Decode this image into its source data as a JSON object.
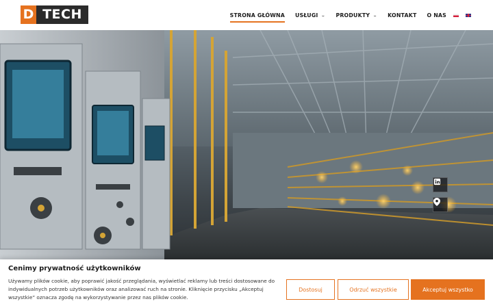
{
  "brand": {
    "logo_d": "D",
    "logo_tech": "TECH",
    "accent_color": "#e5721f"
  },
  "nav": {
    "home": "STRONA GŁÓWNA",
    "services": "USŁUGI",
    "products": "PRODUKTY",
    "contact": "KONTAKT",
    "about": "O NAS",
    "chevron_icon": "chevron-down-icon",
    "flags": [
      "pl-flag-icon",
      "en-flag-icon"
    ]
  },
  "social": {
    "icons": [
      "linkedin-icon",
      "map-pin-icon"
    ]
  },
  "cookie": {
    "title": "Cenimy prywatność użytkowników",
    "text": "Używamy plików cookie, aby poprawić jakość przeglądania, wyświetlać reklamy lub treści dostosowane do indywidualnych potrzeb użytkowników oraz analizować ruch na stronie. Kliknięcie przycisku „Akceptuj wszystkie” oznacza zgodę na wykorzystywanie przez nas plików cookie.",
    "customize": "Dostosuj",
    "reject_all": "Odrzuć wszystkie",
    "accept_all": "Akceptuj wszystko"
  }
}
